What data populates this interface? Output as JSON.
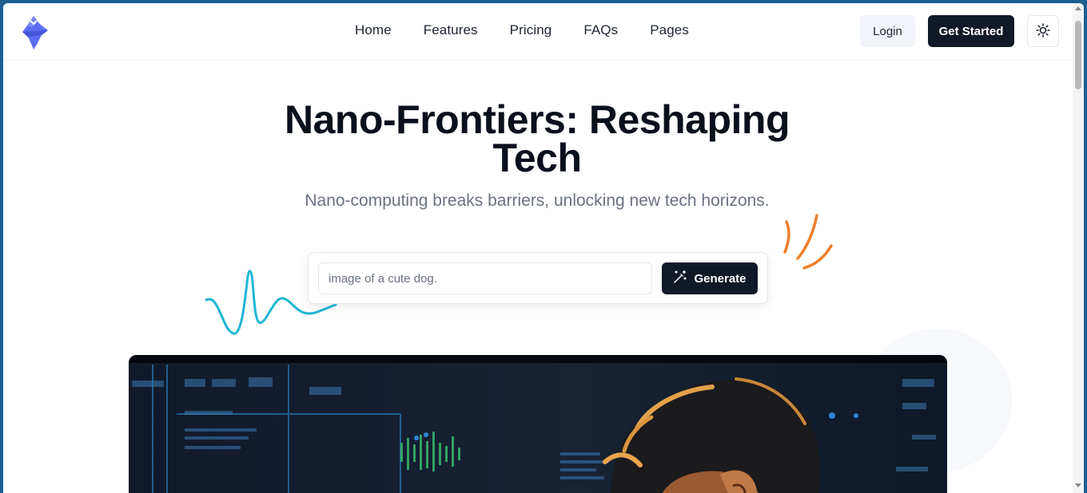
{
  "nav": {
    "items": [
      {
        "label": "Home"
      },
      {
        "label": "Features"
      },
      {
        "label": "Pricing"
      },
      {
        "label": "FAQs"
      },
      {
        "label": "Pages"
      }
    ],
    "login_label": "Login",
    "get_started_label": "Get Started",
    "theme_icon": "sun-icon"
  },
  "hero": {
    "title": "Nano-Frontiers: Reshaping Tech",
    "subtitle": "Nano-computing breaks barriers, unlocking new tech horizons."
  },
  "generator": {
    "input_placeholder": "image of a cute dog.",
    "input_value": "",
    "button_label": "Generate",
    "button_icon": "magic-wand-icon"
  },
  "colors": {
    "accent_dark": "#111827",
    "logo_blue": "#5b6cf2",
    "squiggle_blue": "#1fb6d4",
    "marks_orange": "#f07f2a"
  }
}
